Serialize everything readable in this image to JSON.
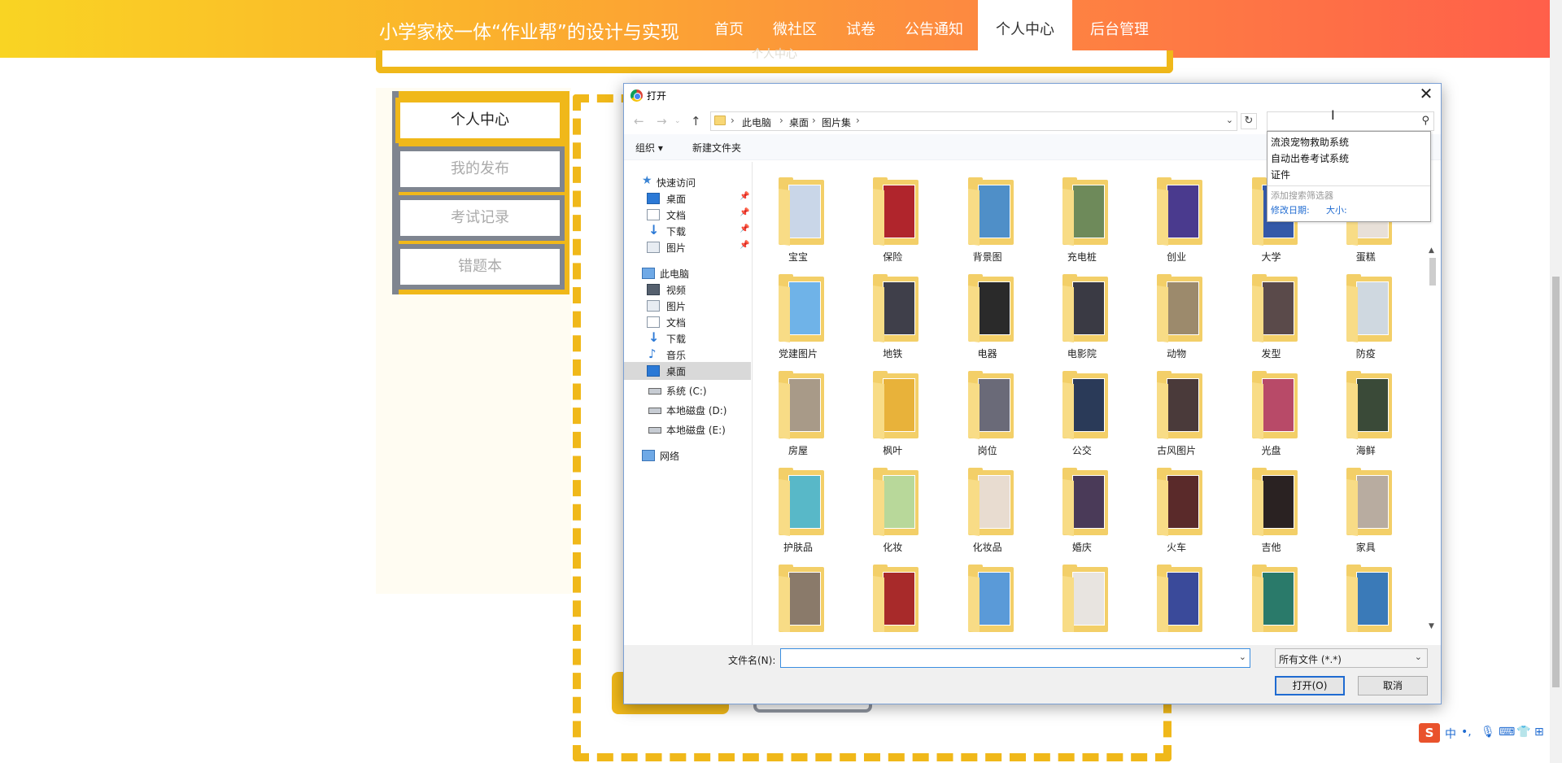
{
  "site": {
    "title": "小学家校一体“作业帮”的设计与实现",
    "nav": [
      "首页",
      "微社区",
      "试卷",
      "公告通知",
      "个人中心",
      "后台管理"
    ],
    "active_nav": "个人中心",
    "top_box_text": "个人中心"
  },
  "sidebar": {
    "items": [
      {
        "label": "个人中心",
        "active": true
      },
      {
        "label": "我的发布",
        "active": false
      },
      {
        "label": "考试记录",
        "active": false
      },
      {
        "label": "错题本",
        "active": false
      }
    ]
  },
  "dialog": {
    "title": "打开",
    "close_glyph": "✕",
    "breadcrumb": [
      "此电脑",
      "桌面",
      "图片集"
    ],
    "search_value": "",
    "toolbar": {
      "organize": "组织 ▾",
      "new_folder": "新建文件夹"
    },
    "search_suggestions": [
      "流浪宠物救助系统",
      "自动出卷考试系统",
      "证件"
    ],
    "search_filter_header": "添加搜索筛选器",
    "search_filters": [
      "修改日期:",
      "大小:"
    ],
    "tree": {
      "quick_access": "快速访问",
      "quick_items": [
        "桌面",
        "文档",
        "下载",
        "图片"
      ],
      "this_pc": "此电脑",
      "pc_items": [
        "视频",
        "图片",
        "文档",
        "下载",
        "音乐",
        "桌面"
      ],
      "drives": [
        "系统 (C:)",
        "本地磁盘 (D:)",
        "本地磁盘 (E:)"
      ],
      "network": "网络",
      "selected": "桌面"
    },
    "files": [
      {
        "name": "宝宝",
        "color": "#c9d6e8"
      },
      {
        "name": "保险",
        "color": "#b0252c"
      },
      {
        "name": "背景图",
        "color": "#4f8fc8"
      },
      {
        "name": "充电桩",
        "color": "#6e8a5a"
      },
      {
        "name": "创业",
        "color": "#4a3a8e"
      },
      {
        "name": "大学",
        "color": "#3459a8"
      },
      {
        "name": "蛋糕",
        "color": "#e8e0d8"
      },
      {
        "name": "党建图片",
        "color": "#6fb3e8"
      },
      {
        "name": "地铁",
        "color": "#3f3f4a"
      },
      {
        "name": "电器",
        "color": "#2a2a2a"
      },
      {
        "name": "电影院",
        "color": "#3a3a44"
      },
      {
        "name": "动物",
        "color": "#9c8a6c"
      },
      {
        "name": "发型",
        "color": "#5a4a4a"
      },
      {
        "name": "防疫",
        "color": "#cfd8e0"
      },
      {
        "name": "房屋",
        "color": "#a89a88"
      },
      {
        "name": "枫叶",
        "color": "#e8b23a"
      },
      {
        "name": "岗位",
        "color": "#6a6a78"
      },
      {
        "name": "公交",
        "color": "#2a3a58"
      },
      {
        "name": "古风图片",
        "color": "#4a3a3a"
      },
      {
        "name": "光盘",
        "color": "#b84a68"
      },
      {
        "name": "海鲜",
        "color": "#3a4a38"
      },
      {
        "name": "护肤品",
        "color": "#58b8c8"
      },
      {
        "name": "化妆",
        "color": "#b8d89a"
      },
      {
        "name": "化妆品",
        "color": "#e8dcd0"
      },
      {
        "name": "婚庆",
        "color": "#4a3a58"
      },
      {
        "name": "火车",
        "color": "#5a2a2a"
      },
      {
        "name": "吉他",
        "color": "#2a2222"
      },
      {
        "name": "家具",
        "color": "#b8aca0"
      },
      {
        "name": "",
        "color": "#8a7a6a"
      },
      {
        "name": "",
        "color": "#a82a2a"
      },
      {
        "name": "",
        "color": "#5a9ad8"
      },
      {
        "name": "",
        "color": "#e8e4e0"
      },
      {
        "name": "",
        "color": "#3a4a9a"
      },
      {
        "name": "",
        "color": "#2a7a6a"
      },
      {
        "name": "",
        "color": "#3a7ab8"
      }
    ],
    "filename_label": "文件名(N):",
    "filename_value": "",
    "file_type": "所有文件 (*.*)",
    "open_button": "打开(O)",
    "cancel_button": "取消"
  },
  "ime": {
    "mode": "中",
    "punct": "•,"
  }
}
